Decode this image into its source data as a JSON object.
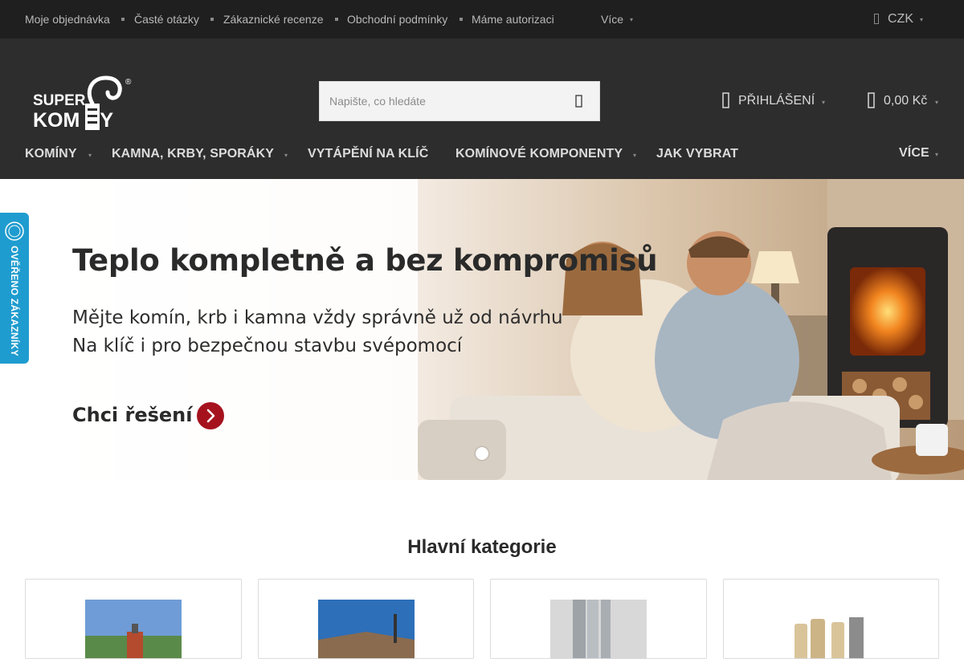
{
  "topbar": {
    "links": [
      "Moje objednávka",
      "Časté otázky",
      "Zákaznické recenze",
      "Obchodní podmínky",
      "Máme autorizaci"
    ],
    "more_label": "Více",
    "currency": "CZK"
  },
  "header": {
    "logo": {
      "line1": "SUPER",
      "line2": "KOMÍNY",
      "reg": "®"
    },
    "search_placeholder": "Napište, co hledáte",
    "login_label": "PŘIHLÁŠENÍ",
    "cart_total": "0,00 Kč"
  },
  "nav": {
    "items": [
      "KOMÍNY",
      "KAMNA, KRBY, SPORÁKY",
      "VYTÁPĚNÍ NA KLÍČ",
      "KOMÍNOVÉ KOMPONENTY",
      "JAK VYBRAT"
    ],
    "more_label": "VÍCE"
  },
  "hero": {
    "title": "Teplo kompletně a bez kompromisů",
    "subtitle_line1": "Mějte komín, krb i kamna vždy správně už od návrhu",
    "subtitle_line2": "Na klíč i pro bezpečnou stavbu svépomocí",
    "cta_label": "Chci řešení"
  },
  "badge": {
    "label": "OVĚŘENO ZÁKAZNÍKY"
  },
  "categories": {
    "heading": "Hlavní kategorie"
  },
  "colors": {
    "topbar": "#1f1f1f",
    "header": "#2d2d2d",
    "accent_red": "#a5121e",
    "badge_blue": "#1f9ccf"
  }
}
